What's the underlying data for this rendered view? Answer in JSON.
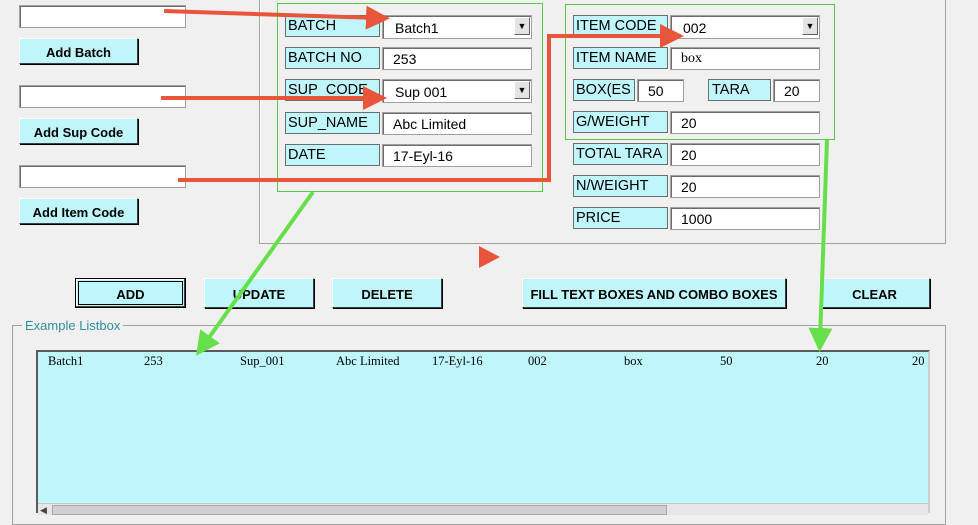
{
  "left_panel": {
    "batch_input": "",
    "add_batch_label": "Add Batch",
    "sup_input": "",
    "add_sup_label": "Add Sup Code",
    "item_input": "",
    "add_item_label": "Add Item Code"
  },
  "form_left": {
    "batch": {
      "label": "BATCH",
      "value": "Batch1"
    },
    "batch_no": {
      "label": "BATCH NO",
      "value": "253"
    },
    "sup_code": {
      "label": "SUP_CODE",
      "value": "Sup  001"
    },
    "sup_name": {
      "label": "SUP_NAME",
      "value": "Abc Limited"
    },
    "date": {
      "label": "DATE",
      "value": "17-Eyl-16"
    }
  },
  "form_right": {
    "item_code": {
      "label": "ITEM CODE",
      "value": "002"
    },
    "item_name": {
      "label": "ITEM NAME",
      "value": "box"
    },
    "boxes": {
      "label": "BOX(ES",
      "value": "50"
    },
    "tara": {
      "label": "TARA",
      "value": "20"
    },
    "g_weight": {
      "label": "G/WEIGHT",
      "value": "20"
    },
    "total_tara": {
      "label": "TOTAL TARA",
      "value": "20"
    },
    "n_weight": {
      "label": "N/WEIGHT",
      "value": "20"
    },
    "price": {
      "label": "PRICE",
      "value": "1000"
    }
  },
  "actions": {
    "add": "ADD",
    "update": "UPDATE",
    "delete": "DELETE",
    "fill": "FILL TEXT BOXES AND COMBO BOXES",
    "clear": "CLEAR"
  },
  "listbox": {
    "legend": "Example Listbox",
    "rows": [
      [
        "Batch1",
        "253",
        "Sup_001",
        "Abc Limited",
        "17-Eyl-16",
        "002",
        "box",
        "50",
        "20",
        "20"
      ]
    ]
  },
  "colors": {
    "cyan": "#bff6fb",
    "annotation_red": "#e8553a",
    "annotation_green": "#66e04a"
  }
}
